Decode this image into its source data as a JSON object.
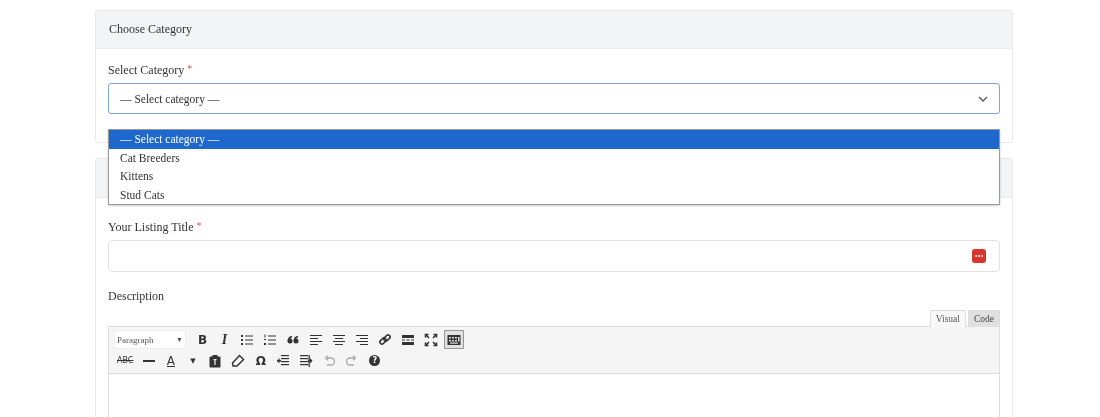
{
  "category_card": {
    "title": "Choose Category",
    "field_label": "Select Category",
    "required_mark": "*",
    "select": {
      "value": "— Select category —",
      "open": true
    },
    "options": [
      {
        "label": "— Select category —",
        "selected": true
      },
      {
        "label": "Cat Breeders",
        "selected": false
      },
      {
        "label": "Kittens",
        "selected": false
      },
      {
        "label": "Stud Cats",
        "selected": false
      }
    ]
  },
  "listing_card": {
    "title_label": "Your Listing Title",
    "required_mark": "*",
    "description_label": "Description",
    "editor_tabs": [
      {
        "label": "Visual",
        "selected": true
      },
      {
        "label": "Code",
        "selected": false
      }
    ],
    "toolbar_rows": [
      [
        {
          "kind": "dropdown",
          "text": "Paragraph",
          "caret": "▼",
          "pressed": false
        },
        {
          "kind": "glyph",
          "text": "B",
          "pressed": false
        },
        {
          "kind": "glyph",
          "text": "I",
          "pressed": false
        },
        {
          "kind": "icon",
          "pressed": false
        },
        {
          "kind": "icon",
          "pressed": false
        },
        {
          "kind": "icon",
          "pressed": false
        },
        {
          "kind": "icon",
          "pressed": false
        },
        {
          "kind": "icon",
          "pressed": false
        },
        {
          "kind": "icon",
          "pressed": false
        },
        {
          "kind": "icon",
          "pressed": false
        },
        {
          "kind": "icon",
          "pressed": false
        },
        {
          "kind": "icon",
          "pressed": false
        },
        {
          "kind": "icon",
          "pressed": true
        }
      ],
      [
        {
          "kind": "glyph",
          "text": "ABC",
          "disabled": false
        },
        {
          "kind": "icon",
          "disabled": false
        },
        {
          "kind": "color",
          "text": "A",
          "caret": "▼",
          "disabled": false
        },
        {
          "kind": "icon",
          "disabled": false
        },
        {
          "kind": "icon",
          "disabled": false
        },
        {
          "kind": "glyph",
          "text": "Ω",
          "disabled": false
        },
        {
          "kind": "icon",
          "disabled": false
        },
        {
          "kind": "icon",
          "disabled": false
        },
        {
          "kind": "icon",
          "disabled": true
        },
        {
          "kind": "icon",
          "disabled": true
        },
        {
          "kind": "help",
          "text": "?",
          "disabled": false
        }
      ]
    ]
  }
}
